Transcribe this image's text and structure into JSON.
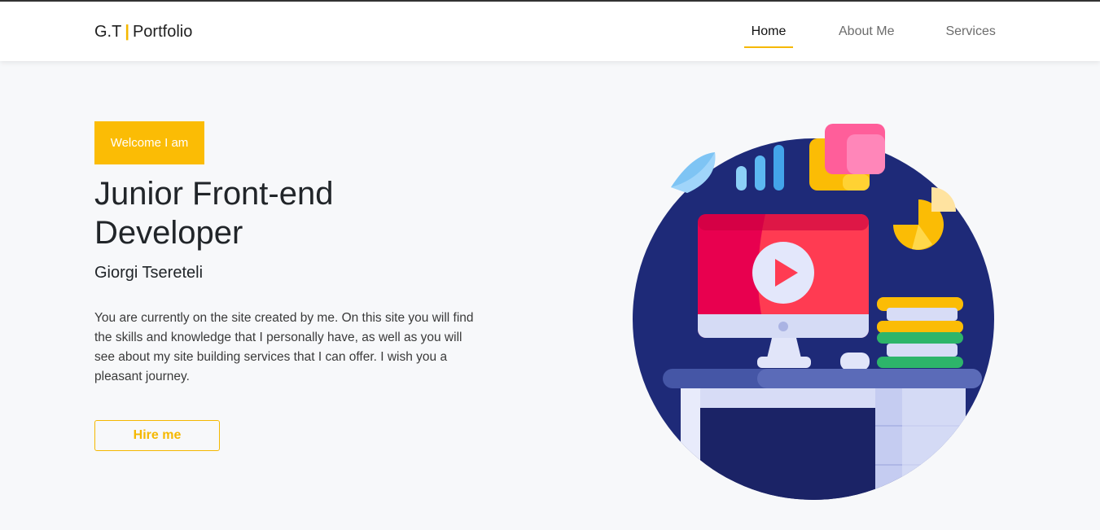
{
  "navbar": {
    "brand_left": "G.T",
    "brand_separator": "|",
    "brand_right": "Portfolio",
    "links": [
      {
        "label": "Home",
        "active": true
      },
      {
        "label": "About Me",
        "active": false
      },
      {
        "label": "Services",
        "active": false
      }
    ]
  },
  "hero": {
    "badge": "Welcome I am",
    "title": "Junior Front-end Developer",
    "name": "Giorgi Tsereteli",
    "description": "You are currently on the site created by me. On this site you will find the skills and knowledge that I personally have, as well as you will see about my site building services that I can offer. I wish you a pleasant journey.",
    "cta_label": "Hire me"
  },
  "colors": {
    "accent": "#fbbc05",
    "circle": "#1e2a78"
  },
  "illustration_icons": [
    "desk-icon",
    "monitor-icon",
    "play-icon",
    "bar-chart-icon",
    "pie-chart-icon",
    "books-icon",
    "sticky-notes-icon"
  ]
}
